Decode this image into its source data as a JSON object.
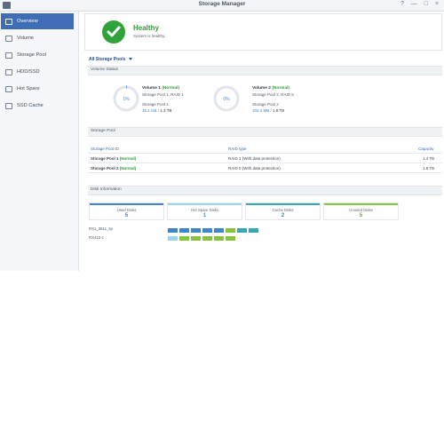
{
  "window": {
    "title": "Storage Manager",
    "controls": "? — □ ×"
  },
  "colors": {
    "healthy": "#2fa33a",
    "used": "#3f86cf",
    "hot_spare": "#9ad6f2",
    "cache": "#3aa8b3",
    "unused": "#86c440",
    "active_nav": "#3f6eb7"
  },
  "sidebar": {
    "items": [
      {
        "label": "Overview",
        "icon": "overview-icon",
        "active": true
      },
      {
        "label": "Volume",
        "icon": "volume-icon",
        "active": false
      },
      {
        "label": "Storage Pool",
        "icon": "storage-pool-icon",
        "active": false
      },
      {
        "label": "HDD/SSD",
        "icon": "hdd-icon",
        "active": false
      },
      {
        "label": "Hot Spare",
        "icon": "hot-spare-icon",
        "active": false
      },
      {
        "label": "SSD Cache",
        "icon": "ssd-cache-icon",
        "active": false
      }
    ]
  },
  "status": {
    "title": "Healthy",
    "subtitle": "System is healthy."
  },
  "pools_selector": "All Storage Pools",
  "sections": {
    "volume_status": "Volume Status",
    "storage_pool": "Storage Pool",
    "disk_info": "Disk Information"
  },
  "volumes": [
    {
      "name": "Volume 1",
      "state": "(Normal)",
      "detail": "Storage Pool 1, RAID 1",
      "pool_label": "Storage Pool 1",
      "used": "15.1 GB",
      "separator": " / ",
      "total": "1.3 TB",
      "percent_text": "1%",
      "percent": 1
    },
    {
      "name": "Volume 2",
      "state": "(Normal)",
      "detail": "Storage Pool 2, RAID 5",
      "pool_label": "Storage Pool 2",
      "used": "102.1 MB",
      "separator": " / ",
      "total": "1.8 TB",
      "percent_text": "0%",
      "percent": 0
    }
  ],
  "pool_table": {
    "headers": {
      "id": "Storage Pool ID",
      "raid": "RAID type",
      "capacity": "Capacity"
    },
    "rows": [
      {
        "id": "Storage Pool 1",
        "state": "(Normal)",
        "raid": "RAID 1 (With data protection)",
        "capacity": "1.4 TB"
      },
      {
        "id": "Storage Pool 2",
        "state": "(Normal)",
        "raid": "RAID 5 (With data protection)",
        "capacity": "1.8 TB"
      }
    ]
  },
  "disk_cards": [
    {
      "label": "Used Disks",
      "count": "5"
    },
    {
      "label": "Hot Spare Disks",
      "count": "1"
    },
    {
      "label": "Cache Disks",
      "count": "2"
    },
    {
      "label": "Unused Disks",
      "count": "5"
    }
  ],
  "hosts": [
    {
      "name": "RS1_3611_sp",
      "slots": [
        "used",
        "used",
        "used",
        "used",
        "used",
        "unused",
        "cache",
        "cache"
      ]
    },
    {
      "name": "RX410-1",
      "slots": [
        "hot_spare",
        "unused",
        "unused",
        "unused",
        "unused",
        "unused"
      ]
    }
  ]
}
